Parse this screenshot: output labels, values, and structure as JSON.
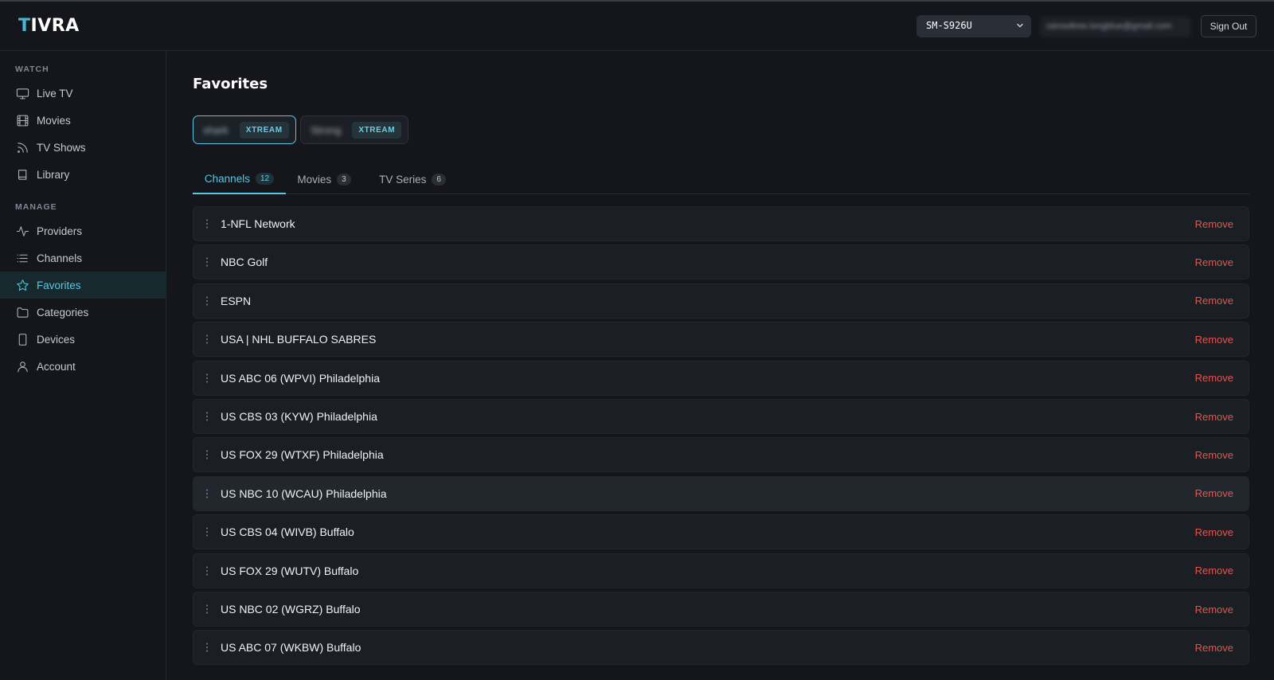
{
  "app": {
    "logo_first": "T",
    "logo_rest": "IVRA"
  },
  "header": {
    "device": "SM-S926U",
    "email": "rainsoltree.longblue@gmail.com",
    "sign_out": "Sign Out"
  },
  "sidebar": {
    "watch_title": "WATCH",
    "watch_items": [
      {
        "label": "Live TV",
        "icon": "tv-icon"
      },
      {
        "label": "Movies",
        "icon": "film-icon"
      },
      {
        "label": "TV Shows",
        "icon": "rss-icon"
      },
      {
        "label": "Library",
        "icon": "book-icon"
      }
    ],
    "manage_title": "MANAGE",
    "manage_items": [
      {
        "label": "Providers",
        "icon": "activity-icon"
      },
      {
        "label": "Channels",
        "icon": "list-icon"
      },
      {
        "label": "Favorites",
        "icon": "star-icon",
        "active": true
      },
      {
        "label": "Categories",
        "icon": "folder-icon"
      },
      {
        "label": "Devices",
        "icon": "device-icon"
      },
      {
        "label": "Account",
        "icon": "user-icon"
      }
    ]
  },
  "main": {
    "title": "Favorites",
    "providers": [
      {
        "name": "shark",
        "type": "XTREAM",
        "active": true
      },
      {
        "name": "Strong",
        "type": "XTREAM",
        "active": false
      }
    ],
    "tabs": [
      {
        "label": "Channels",
        "count": "12",
        "active": true
      },
      {
        "label": "Movies",
        "count": "3"
      },
      {
        "label": "TV Series",
        "count": "6"
      }
    ],
    "remove_label": "Remove",
    "channels": [
      "1-NFL Network",
      "NBC Golf",
      "ESPN",
      "USA | NHL BUFFALO SABRES",
      "US ABC 06 (WPVI) Philadelphia",
      "US CBS 03 (KYW) Philadelphia",
      "US FOX 29 (WTXF) Philadelphia",
      "US NBC 10 (WCAU) Philadelphia",
      "US CBS 04 (WIVB) Buffalo",
      "US FOX 29 (WUTV) Buffalo",
      "US NBC 02 (WGRZ) Buffalo",
      "US ABC 07 (WKBW) Buffalo"
    ]
  },
  "colors": {
    "accent": "#5bc6e0",
    "danger": "#e0574f",
    "background": "#14161b"
  }
}
